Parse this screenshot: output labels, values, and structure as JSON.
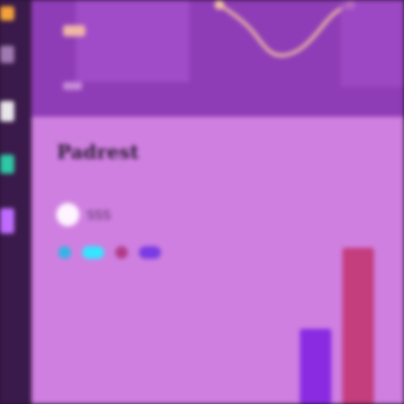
{
  "rail": {
    "items": [
      {
        "icon": "folder-icon",
        "color": "#f3a23a"
      },
      {
        "icon": "list-icon",
        "color": "#9e7ab0"
      },
      {
        "icon": "document-icon",
        "color": "#e9e6ea"
      },
      {
        "icon": "shield-icon",
        "color": "#2fc7a4"
      },
      {
        "icon": "active-app-icon",
        "color": "#c06bff"
      }
    ]
  },
  "header": {
    "sparkline_color": "#f2c3a5"
  },
  "main": {
    "title": "Padrest",
    "user_name": "SSS",
    "legend": [
      {
        "icon": "legend-blue-icon",
        "color": "#2fb6e6"
      },
      {
        "icon": "legend-cyan-icon",
        "color": "#34e6ff"
      },
      {
        "icon": "legend-magenta-icon",
        "color": "#b03a86"
      },
      {
        "icon": "legend-violet-icon",
        "color": "#7b3be3"
      }
    ],
    "bar_colors": [
      "#8a2be2",
      "#c43d7d"
    ]
  },
  "chart_data": {
    "type": "bar",
    "categories": [
      "",
      ""
    ],
    "values": [
      26,
      54
    ],
    "ylim": [
      0,
      60
    ],
    "grid": false,
    "legend": "none"
  }
}
